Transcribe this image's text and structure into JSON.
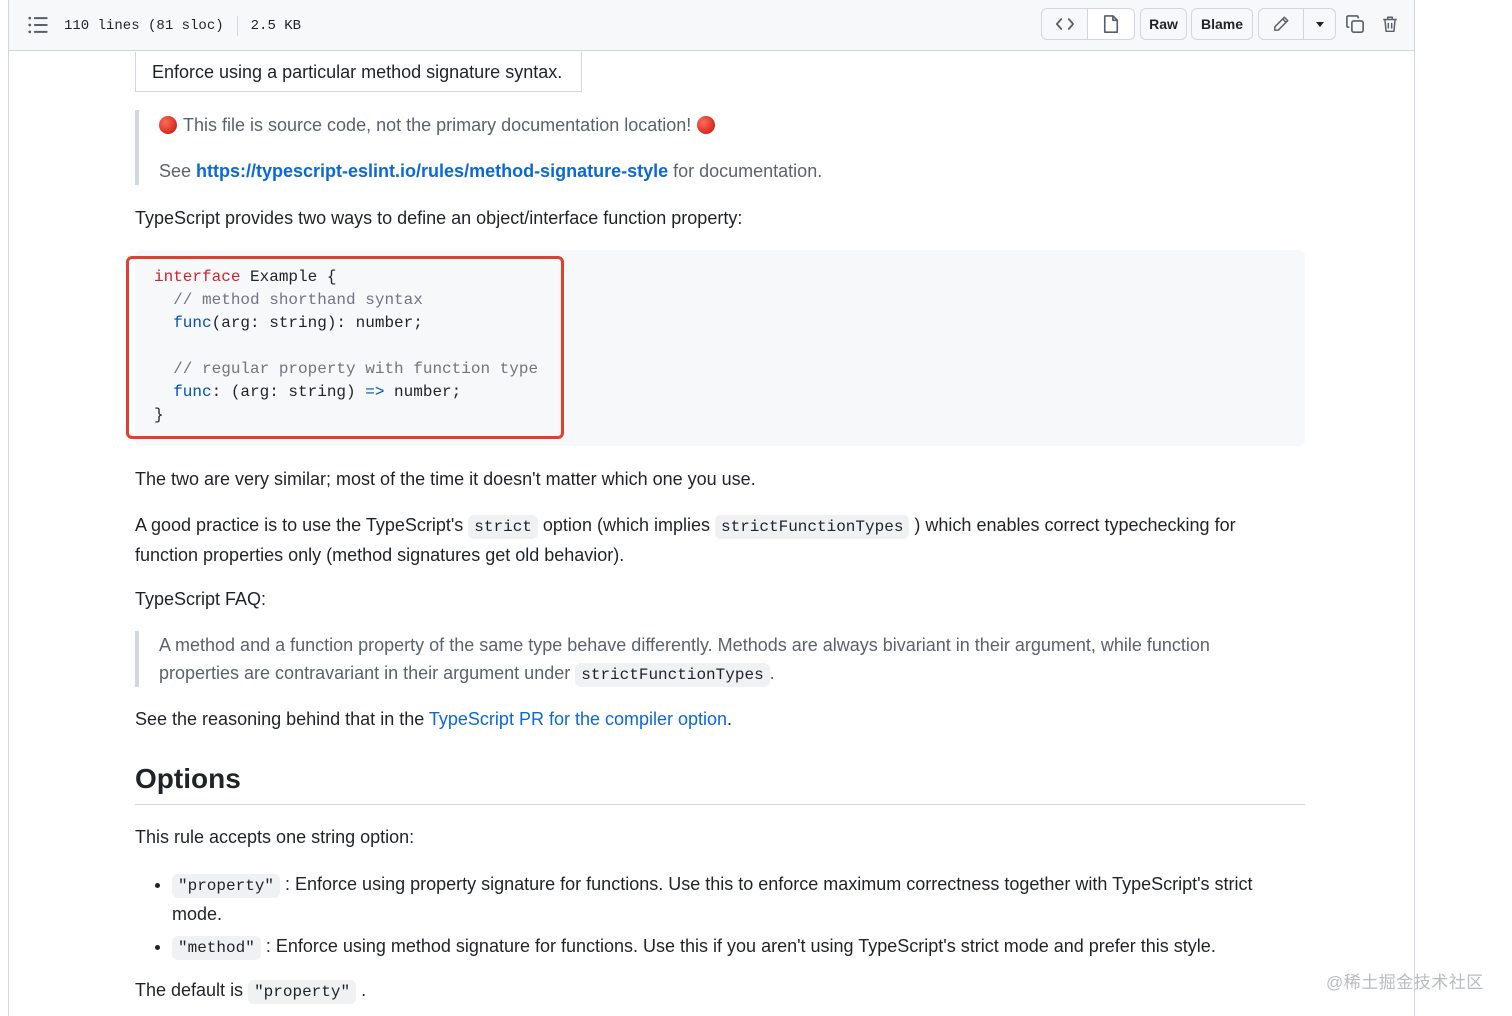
{
  "toolbar": {
    "lines": "110 lines (81 sloc)",
    "size": "2.5 KB",
    "raw_label": "Raw",
    "blame_label": "Blame"
  },
  "article": {
    "summary": "Enforce using a particular method signature syntax.",
    "notice": "This file is source code, not the primary documentation location!",
    "see_prefix": "See ",
    "see_link": "https://typescript-eslint.io/rules/method-signature-style",
    "see_suffix": " for documentation.",
    "intro": "TypeScript provides two ways to define an object/interface function property:",
    "code": {
      "l1_kw": "interface",
      "l1_rest": " Example {",
      "l2": "  // method shorthand syntax",
      "l3_fn": "func",
      "l3_rest": "(arg: string): number;",
      "l5": "  // regular property with function type",
      "l6_fn": "func",
      "l6_mid": ": (arg: string) ",
      "l6_arrow": "=>",
      "l6_rest": " number;",
      "l7": "}"
    },
    "similar": "The two are very similar; most of the time it doesn't matter which one you use.",
    "practice_1": "A good practice is to use the TypeScript's ",
    "practice_code1": "strict",
    "practice_2": " option (which implies ",
    "practice_code2": "strictFunctionTypes",
    "practice_3": " ) which enables correct typechecking for",
    "practice_line2": "function properties only (method signatures get old behavior).",
    "faq_label": "TypeScript FAQ:",
    "faq_quote_1": "A method and a function property of the same type behave differently. Methods are always bivariant in their argument, while function",
    "faq_quote_2": "properties are contravariant in their argument under ",
    "faq_quote_code": "strictFunctionTypes",
    "faq_quote_end": ".",
    "reason_prefix": "See the reasoning behind that in the ",
    "reason_link": "TypeScript PR for the compiler option",
    "reason_suffix": ".",
    "options_heading": "Options",
    "accepts": "This rule accepts one string option:",
    "opt1_code": "\"property\"",
    "opt1_text": " : Enforce using property signature for functions. Use this to enforce maximum correctness together with TypeScript's strict",
    "opt1_text2": "mode.",
    "opt2_code": "\"method\"",
    "opt2_text": " : Enforce using method signature for functions. Use this if you aren't using TypeScript's strict mode and prefer this style.",
    "default_prefix": "The default is ",
    "default_code": "\"property\"",
    "default_suffix": " ."
  },
  "watermark": "@稀土掘金技术社区",
  "icons": {
    "toc": "list-unordered-icon",
    "code": "code-icon",
    "file": "file-icon",
    "edit": "pencil-icon",
    "dropdown": "triangle-down-icon",
    "copy": "copy-icon",
    "delete": "trash-icon",
    "stop": "stop-sign-icon"
  },
  "colors": {
    "link": "#0969da",
    "highlight": "#e0402d",
    "keyword": "#cf222e",
    "comment": "#6e7781",
    "function": "#0550ae"
  }
}
